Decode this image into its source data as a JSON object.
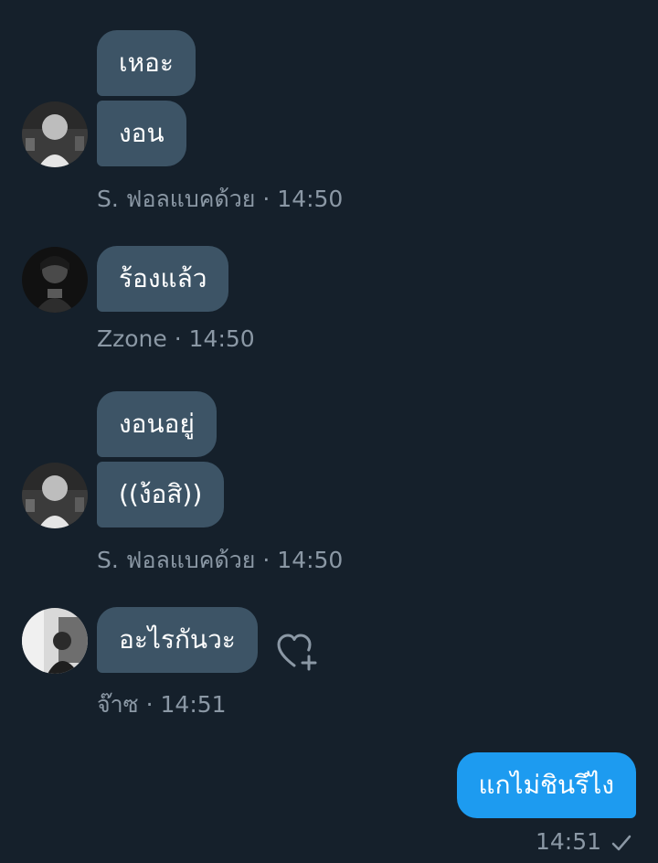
{
  "colors": {
    "background": "#15202b",
    "received_bubble": "#3d5466",
    "sent_bubble": "#1d9bf0",
    "meta_text": "#8b98a5"
  },
  "messages": [
    {
      "bubbles": [
        "เหอะ",
        "งอน"
      ],
      "sender": "S. ฟอลแบคด้วย",
      "time": "14:50",
      "avatar": "avatar-photo-1"
    },
    {
      "bubbles": [
        "ร้องแล้ว"
      ],
      "sender": "Zzone",
      "time": "14:50",
      "avatar": "avatar-photo-2"
    },
    {
      "bubbles": [
        "งอนอยู่",
        "((ง้อสิ))"
      ],
      "sender": "S. ฟอลแบคด้วย",
      "time": "14:50",
      "avatar": "avatar-photo-1"
    },
    {
      "bubbles": [
        "อะไรกันวะ"
      ],
      "sender": "จ๊าซ",
      "time": "14:51",
      "avatar": "avatar-photo-3",
      "reaction_icon": "heart-plus-icon"
    }
  ],
  "own_message": {
    "text": "แกไม่ชินรึไง",
    "time": "14:51",
    "status_icon": "checkmark-icon"
  }
}
